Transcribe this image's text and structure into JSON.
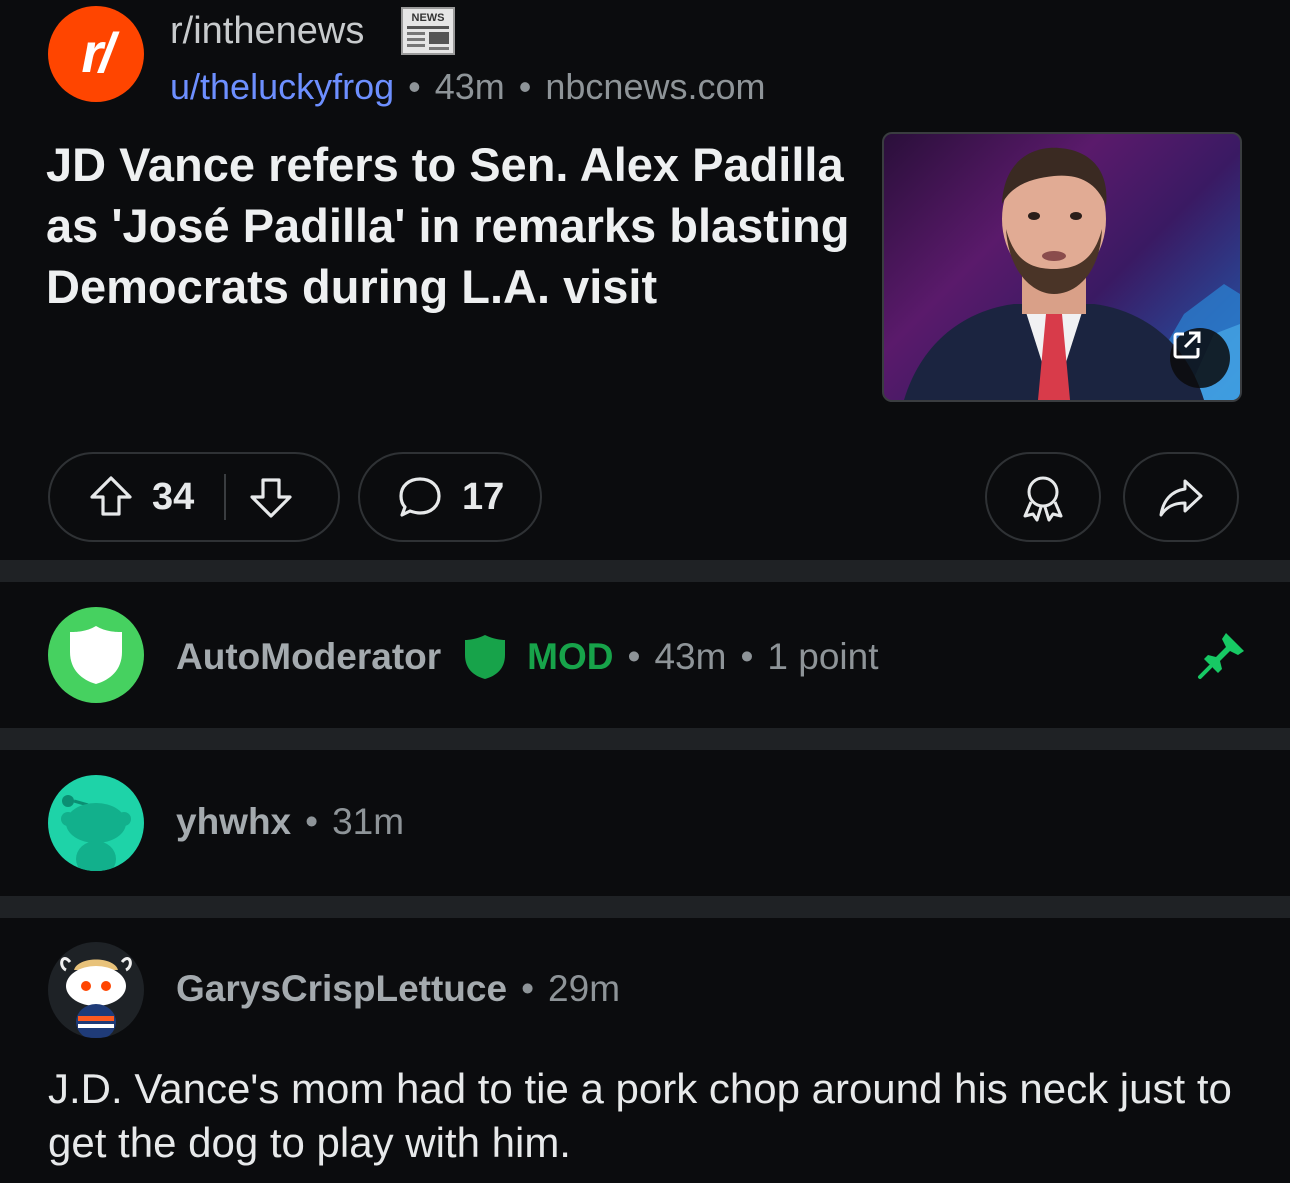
{
  "post": {
    "subreddit": "r/inthenews",
    "subreddit_icon_text": "r/",
    "flair_icon": "newspaper-icon",
    "flair_text": "NEWS",
    "author": "u/theluckyfrog",
    "age": "43m",
    "domain": "nbcnews.com",
    "title": "JD Vance refers to Sen. Alex Padilla as 'José Padilla' in remarks blasting Democrats during L.A. visit",
    "thumbnail_alt": "Photo of JD Vance",
    "upvotes": "34",
    "comments": "17",
    "accent": "#ff4500"
  },
  "comments": [
    {
      "user": "AutoModerator",
      "mod_label": "MOD",
      "age": "43m",
      "points": "1 point",
      "avatar_icon": "shield-avatar",
      "pinned": true,
      "mod_color": "#17a34a"
    },
    {
      "user": "yhwhx",
      "age": "31m",
      "avatar_icon": "snoo-avatar"
    },
    {
      "user": "GarysCrispLettuce",
      "age": "29m",
      "avatar_icon": "snoo-avatar",
      "body": "J.D. Vance's mom had to tie a pork chop around his neck just to get the dog to play with him."
    }
  ]
}
